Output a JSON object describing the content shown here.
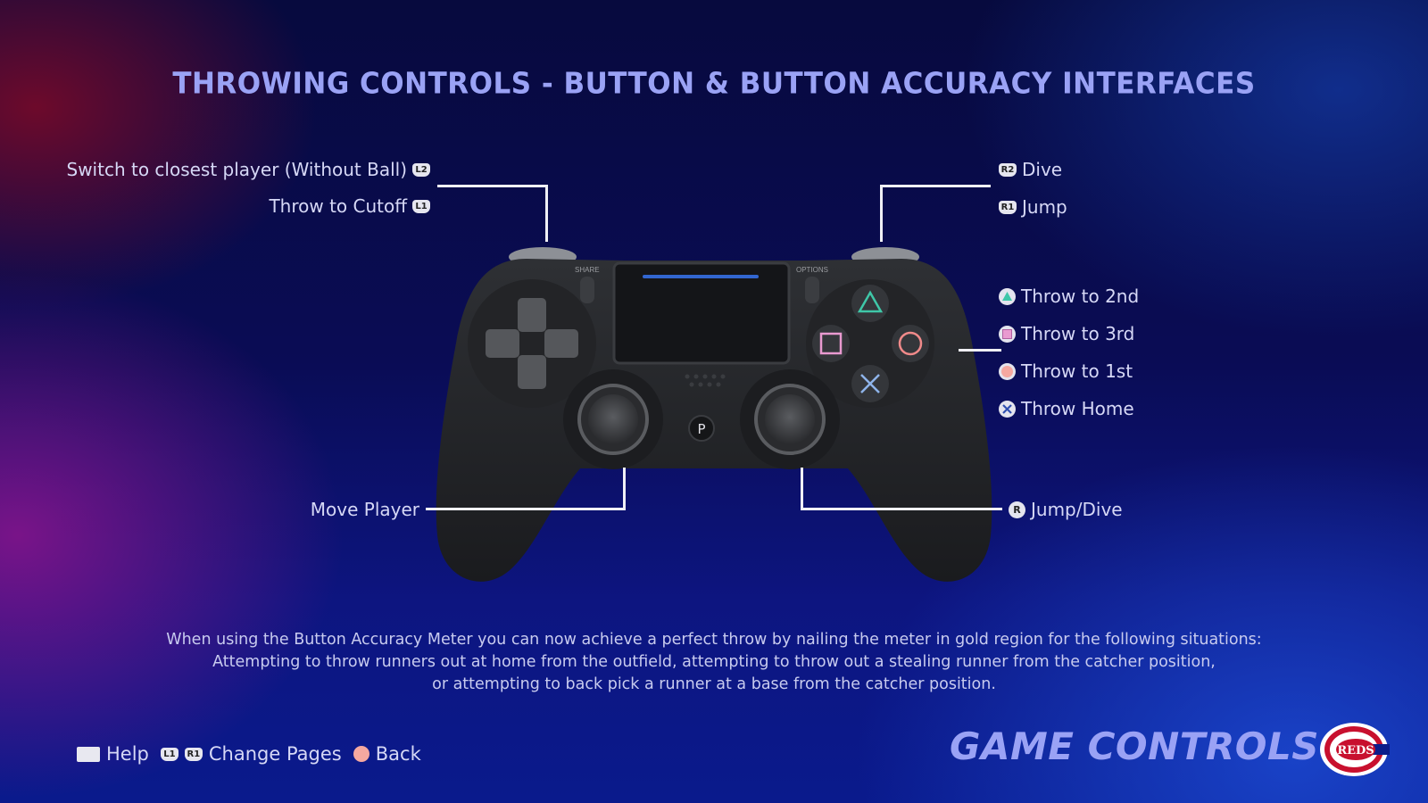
{
  "header": {
    "title": "THROWING CONTROLS - BUTTON & BUTTON ACCURACY INTERFACES"
  },
  "controller": {
    "share_label": "SHARE",
    "options_label": "OPTIONS"
  },
  "left_labels": [
    {
      "text": "Switch to closest player (Without Ball)",
      "button": "L2",
      "icon": "l2-trigger-icon"
    },
    {
      "text": "Throw to Cutoff",
      "button": "L1",
      "icon": "l1-bumper-icon"
    },
    {
      "text": "Move Player",
      "button": "L",
      "icon": "left-stick"
    }
  ],
  "right_labels": [
    {
      "text": "Dive",
      "button": "R2",
      "icon": "r2-trigger-icon"
    },
    {
      "text": "Jump",
      "button": "R1",
      "icon": "r1-bumper-icon"
    },
    {
      "text": "Throw to 2nd",
      "button": "Triangle",
      "icon": "triangle-button-icon"
    },
    {
      "text": "Throw to 3rd",
      "button": "Square",
      "icon": "square-button-icon"
    },
    {
      "text": "Throw to 1st",
      "button": "Circle",
      "icon": "circle-button-icon"
    },
    {
      "text": "Throw Home",
      "button": "Cross",
      "icon": "cross-button-icon"
    },
    {
      "text": "Jump/Dive",
      "button": "R",
      "icon": "r-stick-icon"
    }
  ],
  "description": [
    "When using the Button Accuracy Meter you can now achieve a perfect throw by nailing the meter in gold region for the following situations:",
    "Attempting to throw runners out at home from the outfield, attempting to throw out a stealing runner from the catcher position,",
    "or attempting to back pick a runner at a base from the catcher position."
  ],
  "footer": {
    "help_label": "Help",
    "l1": "L1",
    "r1": "R1",
    "change_pages_label": "Change Pages",
    "back_label": "Back"
  },
  "branding": {
    "section_title": "GAME CONTROLS",
    "team_logo_text": "REDS"
  },
  "colors": {
    "title": "#9aa2f5",
    "triangle": "#3fc7a8",
    "square": "#e99ad0",
    "circle": "#f08a8a",
    "cross": "#6f8fe0",
    "reds_red": "#c8102e"
  }
}
